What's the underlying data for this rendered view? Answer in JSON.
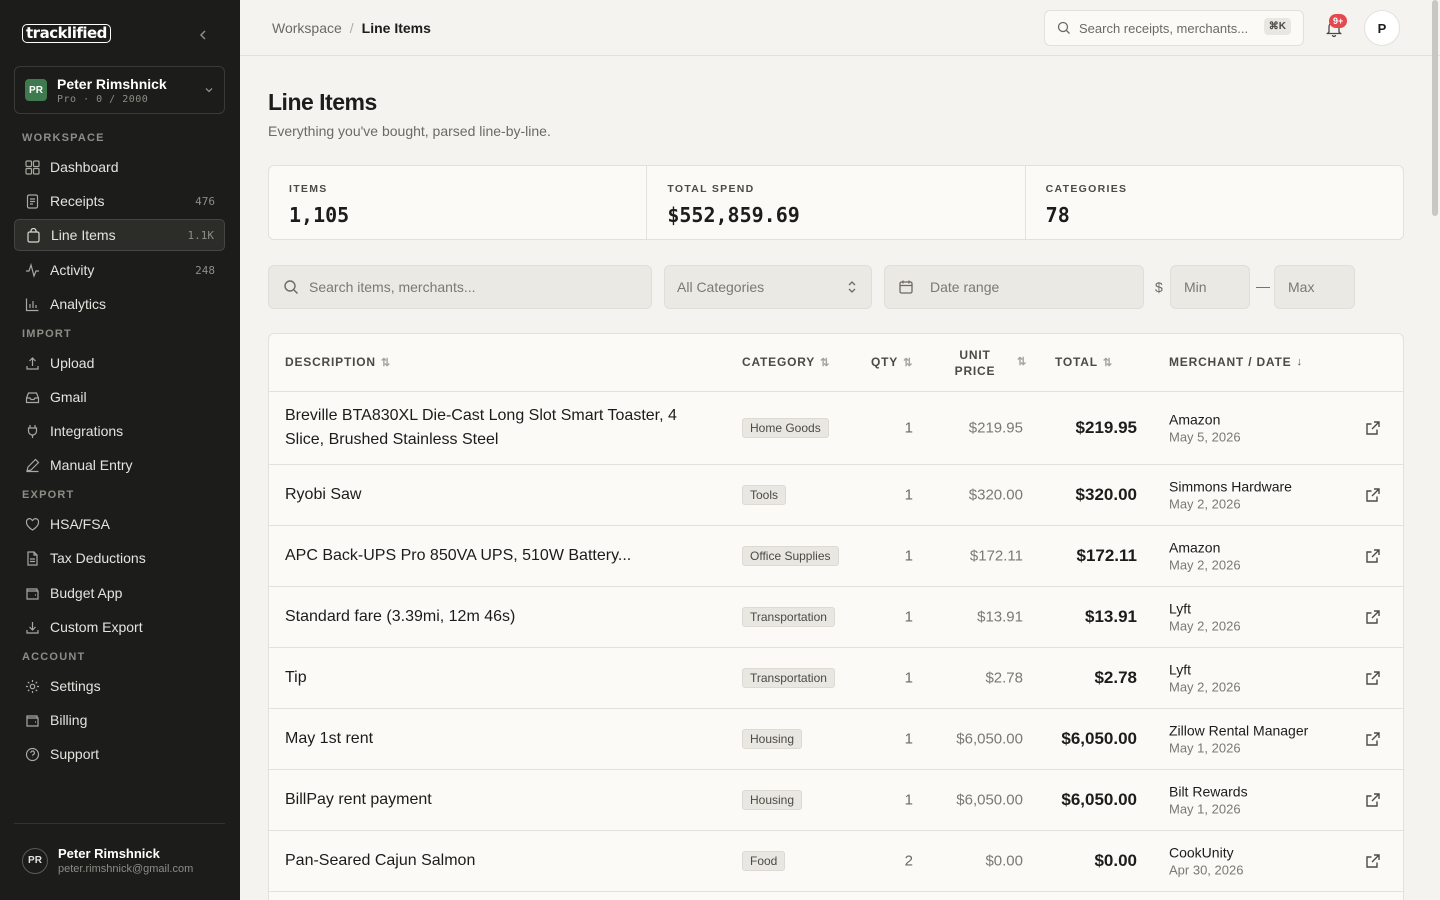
{
  "app": {
    "logo_text": "tracklified"
  },
  "account": {
    "initials": "PR",
    "name": "Peter Rimshnick",
    "plan": "Pro · 0 / 2000"
  },
  "nav": {
    "workspace_label": "WORKSPACE",
    "import_label": "IMPORT",
    "export_label": "EXPORT",
    "account_label": "ACCOUNT",
    "items": [
      {
        "label": "Dashboard",
        "count": "",
        "icon": "dashboard-icon"
      },
      {
        "label": "Receipts",
        "count": "476",
        "icon": "receipt-icon"
      },
      {
        "label": "Line Items",
        "count": "1.1K",
        "icon": "bag-icon"
      },
      {
        "label": "Activity",
        "count": "248",
        "icon": "activity-icon"
      },
      {
        "label": "Analytics",
        "count": "",
        "icon": "bar-chart-icon"
      },
      {
        "label": "Upload",
        "count": "",
        "icon": "upload-icon"
      },
      {
        "label": "Gmail",
        "count": "",
        "icon": "inbox-icon"
      },
      {
        "label": "Integrations",
        "count": "",
        "icon": "plug-icon"
      },
      {
        "label": "Manual Entry",
        "count": "",
        "icon": "pen-icon"
      },
      {
        "label": "HSA/FSA",
        "count": "",
        "icon": "heart-icon"
      },
      {
        "label": "Tax Deductions",
        "count": "",
        "icon": "document-icon"
      },
      {
        "label": "Budget App",
        "count": "",
        "icon": "wallet-icon"
      },
      {
        "label": "Custom Export",
        "count": "",
        "icon": "download-icon"
      },
      {
        "label": "Settings",
        "count": "",
        "icon": "gear-icon"
      },
      {
        "label": "Billing",
        "count": "",
        "icon": "wallet-icon"
      },
      {
        "label": "Support",
        "count": "",
        "icon": "help-icon"
      }
    ]
  },
  "user": {
    "initials": "PR",
    "name": "Peter Rimshnick",
    "email": "peter.rimshnick@gmail.com"
  },
  "topbar": {
    "breadcrumb_root": "Workspace",
    "breadcrumb_sep": "/",
    "breadcrumb_current": "Line Items",
    "search_placeholder": "Search receipts, merchants...",
    "search_shortcut": "⌘K",
    "notifications_badge": "9+",
    "avatar_initial": "P"
  },
  "page": {
    "title": "Line Items",
    "subtitle": "Everything you've bought, parsed line-by-line."
  },
  "stats": [
    {
      "label": "ITEMS",
      "value": "1,105"
    },
    {
      "label": "TOTAL SPEND",
      "value": "$552,859.69"
    },
    {
      "label": "CATEGORIES",
      "value": "78"
    }
  ],
  "filters": {
    "search_placeholder": "Search items, merchants...",
    "category_selected": "All Categories",
    "date_placeholder": "Date range",
    "currency_symbol": "$",
    "min_placeholder": "Min",
    "range_dash": "—",
    "max_placeholder": "Max"
  },
  "table": {
    "headers": {
      "description": "DESCRIPTION",
      "category": "CATEGORY",
      "qty": "QTY",
      "unit_price_1": "UNIT",
      "unit_price_2": "PRICE",
      "total": "TOTAL",
      "merchant_date": "MERCHANT / DATE"
    },
    "rows": [
      {
        "description": "Breville BTA830XL Die-Cast Long Slot Smart Toaster, 4 Slice, Brushed Stainless Steel",
        "category": "Home Goods",
        "qty": "1",
        "unit_price": "$219.95",
        "total": "$219.95",
        "merchant": "Amazon",
        "date": "May 5, 2026"
      },
      {
        "description": "Ryobi Saw",
        "category": "Tools",
        "qty": "1",
        "unit_price": "$320.00",
        "total": "$320.00",
        "merchant": "Simmons Hardware",
        "date": "May 2, 2026"
      },
      {
        "description": "APC Back-UPS Pro 850VA UPS, 510W Battery...",
        "category": "Office Supplies",
        "qty": "1",
        "unit_price": "$172.11",
        "total": "$172.11",
        "merchant": "Amazon",
        "date": "May 2, 2026"
      },
      {
        "description": "Standard fare (3.39mi, 12m 46s)",
        "category": "Transportation",
        "qty": "1",
        "unit_price": "$13.91",
        "total": "$13.91",
        "merchant": "Lyft",
        "date": "May 2, 2026"
      },
      {
        "description": "Tip",
        "category": "Transportation",
        "qty": "1",
        "unit_price": "$2.78",
        "total": "$2.78",
        "merchant": "Lyft",
        "date": "May 2, 2026"
      },
      {
        "description": "May 1st rent",
        "category": "Housing",
        "qty": "1",
        "unit_price": "$6,050.00",
        "total": "$6,050.00",
        "merchant": "Zillow Rental Manager",
        "date": "May 1, 2026"
      },
      {
        "description": "BillPay rent payment",
        "category": "Housing",
        "qty": "1",
        "unit_price": "$6,050.00",
        "total": "$6,050.00",
        "merchant": "Bilt Rewards",
        "date": "May 1, 2026"
      },
      {
        "description": "Pan-Seared Cajun Salmon",
        "category": "Food",
        "qty": "2",
        "unit_price": "$0.00",
        "total": "$0.00",
        "merchant": "CookUnity",
        "date": "Apr 30, 2026"
      }
    ]
  }
}
